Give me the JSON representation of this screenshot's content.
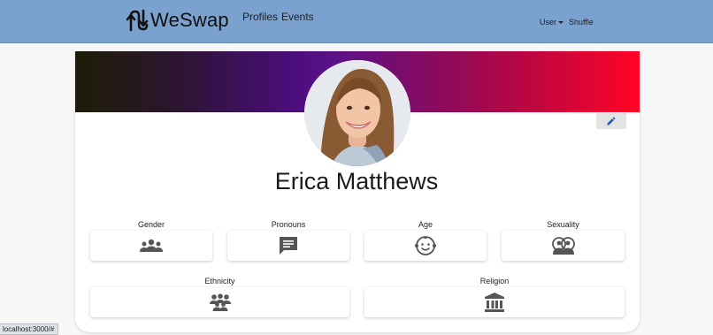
{
  "navbar": {
    "brand": "WeSwap",
    "links": [
      "Profiles",
      "Events"
    ],
    "user_label": "User",
    "shuffle_label": "Shuffle"
  },
  "profile": {
    "name": "Erica Matthews",
    "banner_colors": [
      "#1d1d06",
      "#4a0d79",
      "#ff0426"
    ]
  },
  "attributes": {
    "gender": {
      "label": "Gender",
      "icon": "people-group-icon"
    },
    "pronouns": {
      "label": "Pronouns",
      "icon": "speech-bubble-icon"
    },
    "age": {
      "label": "Age",
      "icon": "baby-face-icon"
    },
    "sexuality": {
      "label": "Sexuality",
      "icon": "couple-icon"
    },
    "ethnicity": {
      "label": "Ethnicity",
      "icon": "diverse-people-icon"
    },
    "religion": {
      "label": "Religion",
      "icon": "institution-icon"
    }
  },
  "status_url": "localhost:3000/#"
}
